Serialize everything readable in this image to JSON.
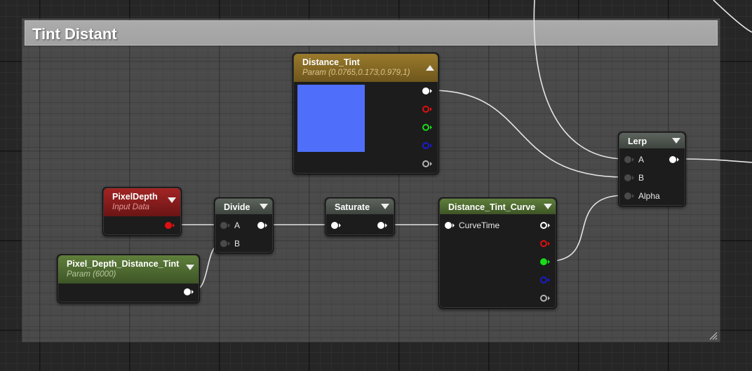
{
  "comment": {
    "title": "Tint Distant"
  },
  "nodes": {
    "distance_tint": {
      "title": "Distance_Tint",
      "subtitle": "Param (0.0765,0.173,0.979,1)",
      "swatch_color": "#4f6ffa"
    },
    "pixel_depth": {
      "title": "PixelDepth",
      "subtitle": "Input Data"
    },
    "pixel_depth_distance_tint": {
      "title": "Pixel_Depth_Distance_Tint",
      "subtitle": "Param (6000)"
    },
    "divide": {
      "title": "Divide",
      "pins": {
        "a": "A",
        "b": "B"
      }
    },
    "saturate": {
      "title": "Saturate"
    },
    "curve": {
      "title": "Distance_Tint_Curve",
      "pins": {
        "curve_time": "CurveTime"
      }
    },
    "lerp": {
      "title": "Lerp",
      "pins": {
        "a": "A",
        "b": "B",
        "alpha": "Alpha"
      }
    }
  },
  "colors": {
    "pin_white": "#ffffff",
    "pin_red": "#e01010",
    "pin_green": "#18dc18",
    "pin_blue": "#1a1ad0",
    "pin_grey": "#b4b4b4",
    "pin_unconnected": "#4a4a4a",
    "wire": "#e4e4e4"
  }
}
